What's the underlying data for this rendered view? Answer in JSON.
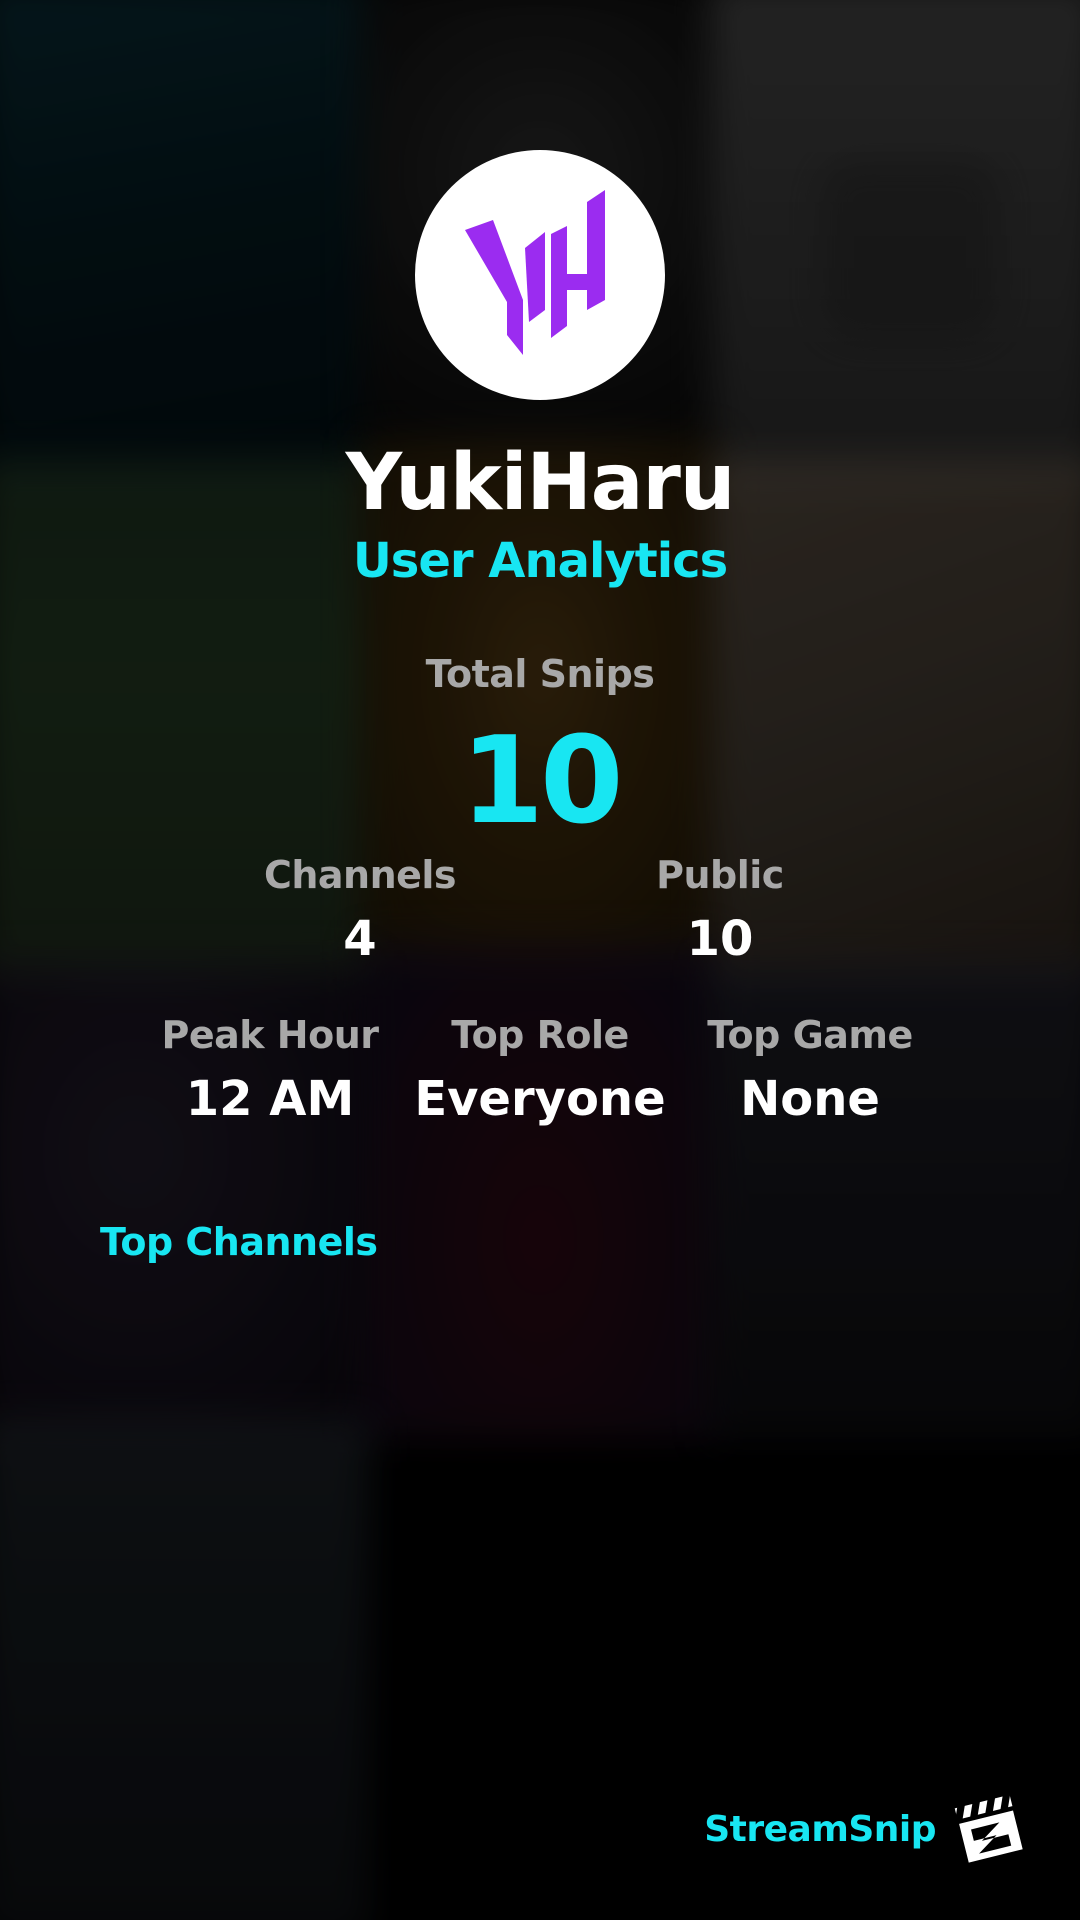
{
  "profile": {
    "username": "YukiHaru",
    "subtitle": "User Analytics",
    "avatar_text": "YH"
  },
  "stats": {
    "total_snips_label": "Total Snips",
    "total_snips_value": "10",
    "channels_label": "Channels",
    "channels_value": "4",
    "public_label": "Public",
    "public_value": "10",
    "peak_hour_label": "Peak Hour",
    "peak_hour_value": "12 AM",
    "top_role_label": "Top Role",
    "top_role_value": "Everyone",
    "top_game_label": "Top Game",
    "top_game_value": "None"
  },
  "top_channels": {
    "heading": "Top Channels"
  },
  "brand": {
    "name": "StreamSnip",
    "logo_icon": "clapperboard-icon"
  },
  "colors": {
    "accent": "#18e6f2",
    "avatar_logo": "#9b2cf0",
    "label_gray": "#a8a8a8",
    "text_white": "#ffffff"
  }
}
